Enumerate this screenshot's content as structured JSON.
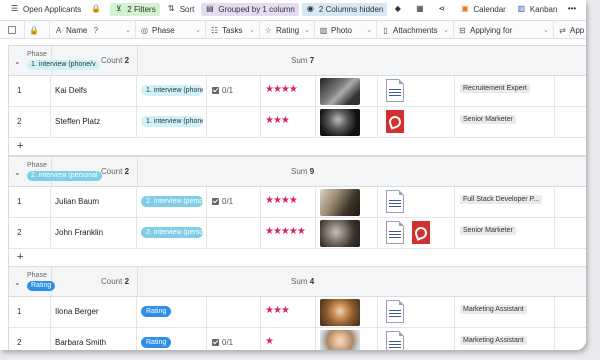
{
  "toolbar": {
    "view_label": "Open Applicants",
    "filters_label": "2 Filters",
    "sort_label": "Sort",
    "group_label": "Grouped by 1 column",
    "hidden_label": "2 Columns hidden",
    "calendar_label": "Calendar",
    "kanban_label": "Kanban"
  },
  "columns": [
    {
      "label": "Name",
      "icon": "text-icon"
    },
    {
      "label": "Phase",
      "icon": "single-select-icon"
    },
    {
      "label": "Tasks",
      "icon": "checklist-icon"
    },
    {
      "label": "Rating",
      "icon": "rating-icon"
    },
    {
      "label": "Photo",
      "icon": "image-icon"
    },
    {
      "label": "Attachments",
      "icon": "file-icon"
    },
    {
      "label": "Applying for",
      "icon": "link-icon"
    },
    {
      "label": "App",
      "icon": "text-icon"
    }
  ],
  "colors": {
    "accent": "#1e88e5",
    "star": "#e0245e",
    "phase1": "#d1f1f9",
    "phase2": "#7fcde6",
    "phase3": "#2f8fe8"
  },
  "groups": [
    {
      "phase_label": "Phase",
      "phase_value": "1. interview (phone/v",
      "count_label": "Count",
      "count": "2",
      "sum_label": "Sum",
      "sum": "7",
      "rows": [
        {
          "num": "1",
          "name": "Kai Delfs",
          "phase": "1. interview (phone/v",
          "tasks": "0/1",
          "rating": "★★★★",
          "applying": "Recruitement Expert"
        },
        {
          "num": "2",
          "name": "Steffen Platz",
          "phase": "1. interview (phone/v",
          "tasks": "",
          "rating": "★★★",
          "applying": "Senior Marketer"
        }
      ]
    },
    {
      "phase_label": "Phase",
      "phase_value": "2. interview (personal",
      "count_label": "Count",
      "count": "2",
      "sum_label": "Sum",
      "sum": "9",
      "rows": [
        {
          "num": "1",
          "name": "Julian Baum",
          "phase": "2. interview (personal",
          "tasks": "0/1",
          "rating": "★★★★",
          "applying": "Full Stack Developer P..."
        },
        {
          "num": "2",
          "name": "John Franklin",
          "phase": "2. interview (personal",
          "tasks": "",
          "rating": "★★★★★",
          "applying": "Senior Marketer"
        }
      ]
    },
    {
      "phase_label": "Phase",
      "phase_value": "Rating",
      "count_label": "Count",
      "count": "2",
      "sum_label": "Sum",
      "sum": "4",
      "rows": [
        {
          "num": "1",
          "name": "Ilona Berger",
          "phase": "Rating",
          "tasks": "",
          "rating": "★★★",
          "applying": "Marketing Assistant"
        },
        {
          "num": "2",
          "name": "Barbara Smith",
          "phase": "Rating",
          "tasks": "0/1",
          "rating": "★",
          "applying": "Marketing Assistant"
        }
      ]
    }
  ],
  "add_row_label": "+"
}
